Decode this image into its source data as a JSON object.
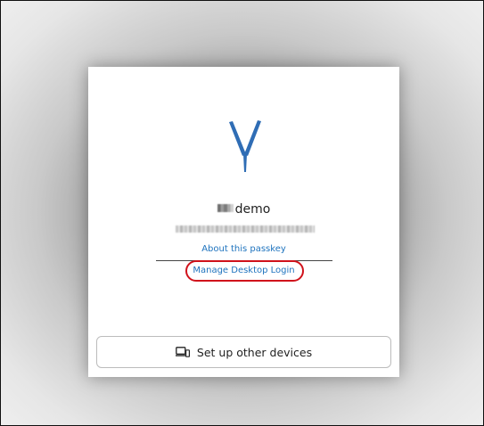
{
  "dialog": {
    "logo_icon": "yubico-logo-icon",
    "username_suffix": "demo",
    "about_link": "About this passkey",
    "manage_link": "Manage Desktop Login",
    "setup_button_label": "Set up other devices",
    "setup_button_icon": "devices-icon",
    "accent_color": "#1e73be",
    "highlight_color": "#d0121b"
  }
}
